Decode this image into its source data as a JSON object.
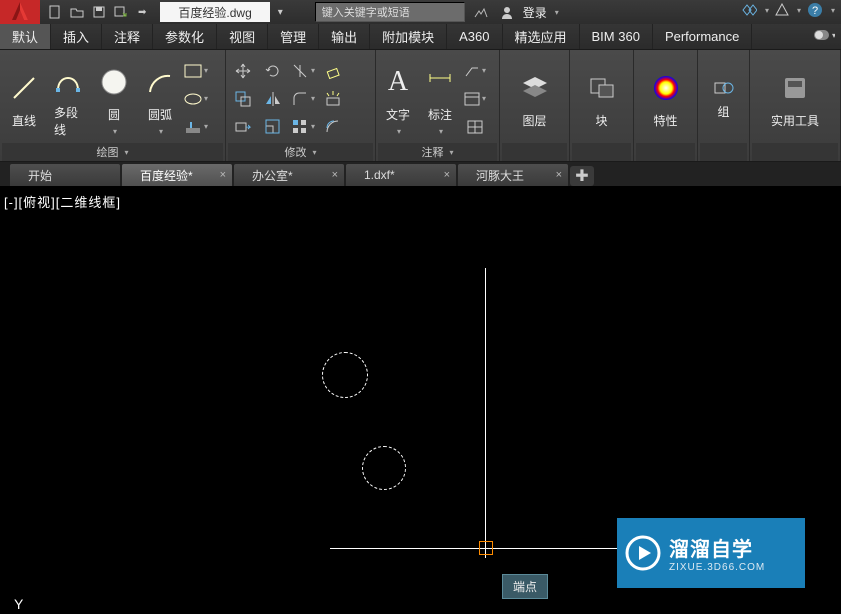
{
  "filename": "百度经验.dwg",
  "search_placeholder": "键入关键字或短语",
  "login_label": "登录",
  "menu_tabs": [
    "默认",
    "插入",
    "注释",
    "参数化",
    "视图",
    "管理",
    "输出",
    "附加模块",
    "A360",
    "精选应用",
    "BIM 360",
    "Performance"
  ],
  "ribbon": {
    "draw": {
      "label": "绘图",
      "line": "直线",
      "polyline": "多段线",
      "circle": "圆",
      "arc": "圆弧"
    },
    "modify": {
      "label": "修改"
    },
    "annotate": {
      "label": "注释",
      "text": "文字",
      "dim": "标注"
    },
    "layer": {
      "label": "图层"
    },
    "block": {
      "label": "块"
    },
    "properties": {
      "label": "特性"
    },
    "group": {
      "label": "组"
    },
    "util": {
      "label": "实用工具"
    }
  },
  "doc_tabs": [
    {
      "label": "开始",
      "active": false,
      "closable": false
    },
    {
      "label": "百度经验*",
      "active": true,
      "closable": true
    },
    {
      "label": "办公室*",
      "active": false,
      "closable": true
    },
    {
      "label": "1.dxf*",
      "active": false,
      "closable": true
    },
    {
      "label": "河豚大王",
      "active": false,
      "closable": true
    }
  ],
  "view_label": "[-][俯视][二维线框]",
  "tooltip": "端点",
  "ucs_y": "Y",
  "watermark": {
    "title": "溜溜自学",
    "sub": "ZIXUE.3D66.COM"
  }
}
